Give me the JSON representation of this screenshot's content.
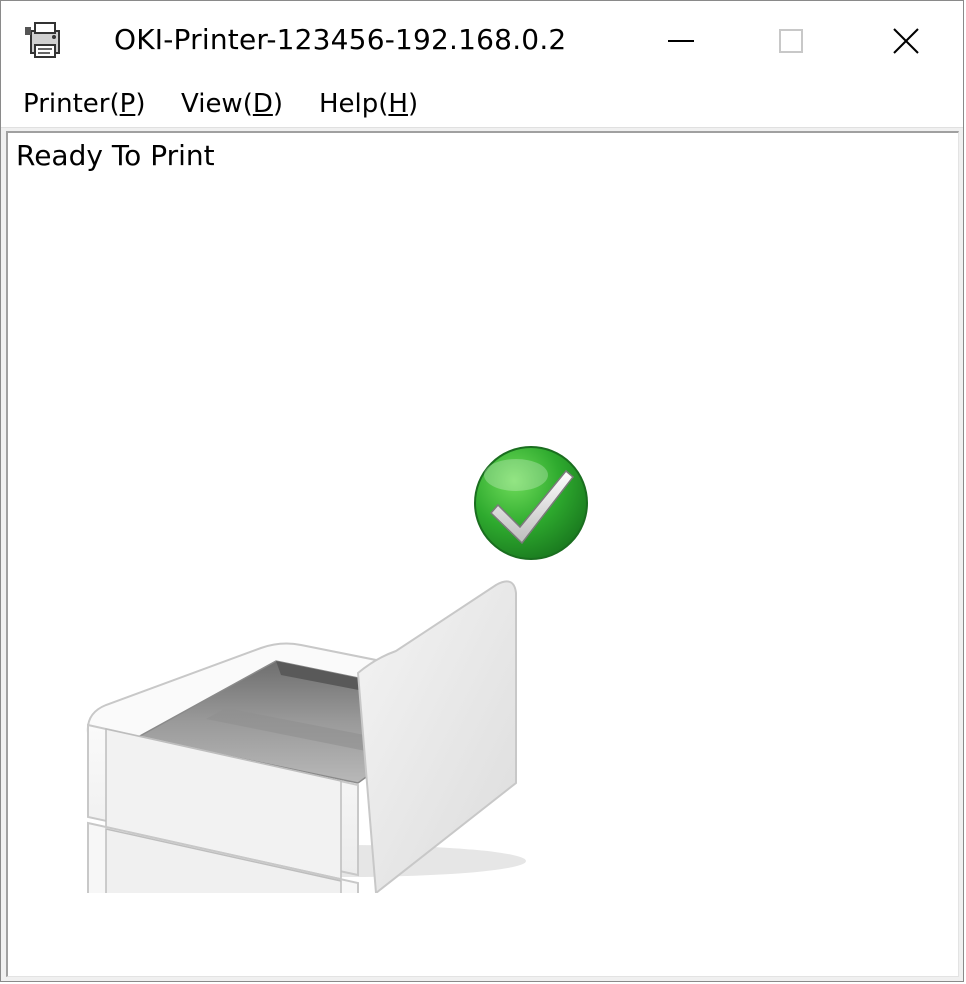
{
  "window": {
    "title": "OKI-Printer-123456-192.168.0.2"
  },
  "controls": {
    "minimize": "minimize-icon",
    "maximize": "maximize-icon",
    "close": "close-icon"
  },
  "menu": {
    "items": [
      {
        "prefix": "Printer(",
        "mnemonic": "P",
        "suffix": ")"
      },
      {
        "prefix": "View(",
        "mnemonic": "D",
        "suffix": ")"
      },
      {
        "prefix": "Help(",
        "mnemonic": "H",
        "suffix": ")"
      }
    ]
  },
  "status": {
    "text": "Ready To Print",
    "indicator_icon": "green-checkmark-icon",
    "indicator_color": "#2eaa2e"
  },
  "illustration": {
    "icon": "printer-icon"
  }
}
